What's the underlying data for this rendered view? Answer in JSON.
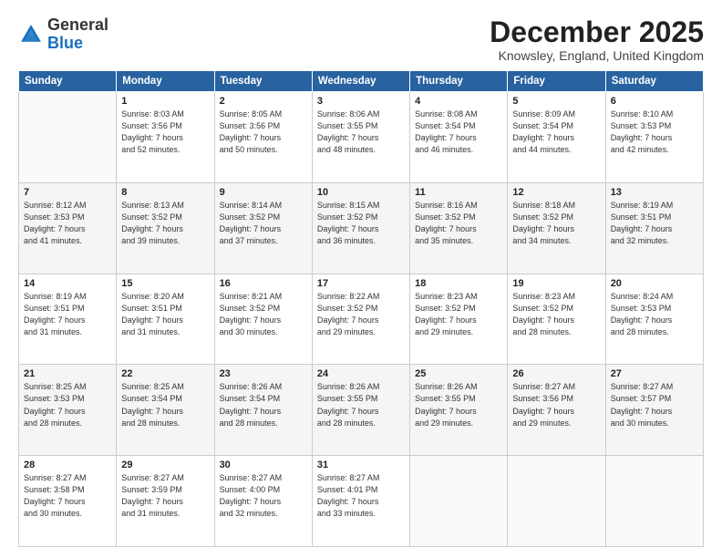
{
  "logo": {
    "general": "General",
    "blue": "Blue"
  },
  "title": "December 2025",
  "location": "Knowsley, England, United Kingdom",
  "days_of_week": [
    "Sunday",
    "Monday",
    "Tuesday",
    "Wednesday",
    "Thursday",
    "Friday",
    "Saturday"
  ],
  "weeks": [
    [
      {
        "day": "",
        "info": ""
      },
      {
        "day": "1",
        "info": "Sunrise: 8:03 AM\nSunset: 3:56 PM\nDaylight: 7 hours\nand 52 minutes."
      },
      {
        "day": "2",
        "info": "Sunrise: 8:05 AM\nSunset: 3:56 PM\nDaylight: 7 hours\nand 50 minutes."
      },
      {
        "day": "3",
        "info": "Sunrise: 8:06 AM\nSunset: 3:55 PM\nDaylight: 7 hours\nand 48 minutes."
      },
      {
        "day": "4",
        "info": "Sunrise: 8:08 AM\nSunset: 3:54 PM\nDaylight: 7 hours\nand 46 minutes."
      },
      {
        "day": "5",
        "info": "Sunrise: 8:09 AM\nSunset: 3:54 PM\nDaylight: 7 hours\nand 44 minutes."
      },
      {
        "day": "6",
        "info": "Sunrise: 8:10 AM\nSunset: 3:53 PM\nDaylight: 7 hours\nand 42 minutes."
      }
    ],
    [
      {
        "day": "7",
        "info": "Sunrise: 8:12 AM\nSunset: 3:53 PM\nDaylight: 7 hours\nand 41 minutes."
      },
      {
        "day": "8",
        "info": "Sunrise: 8:13 AM\nSunset: 3:52 PM\nDaylight: 7 hours\nand 39 minutes."
      },
      {
        "day": "9",
        "info": "Sunrise: 8:14 AM\nSunset: 3:52 PM\nDaylight: 7 hours\nand 37 minutes."
      },
      {
        "day": "10",
        "info": "Sunrise: 8:15 AM\nSunset: 3:52 PM\nDaylight: 7 hours\nand 36 minutes."
      },
      {
        "day": "11",
        "info": "Sunrise: 8:16 AM\nSunset: 3:52 PM\nDaylight: 7 hours\nand 35 minutes."
      },
      {
        "day": "12",
        "info": "Sunrise: 8:18 AM\nSunset: 3:52 PM\nDaylight: 7 hours\nand 34 minutes."
      },
      {
        "day": "13",
        "info": "Sunrise: 8:19 AM\nSunset: 3:51 PM\nDaylight: 7 hours\nand 32 minutes."
      }
    ],
    [
      {
        "day": "14",
        "info": "Sunrise: 8:19 AM\nSunset: 3:51 PM\nDaylight: 7 hours\nand 31 minutes."
      },
      {
        "day": "15",
        "info": "Sunrise: 8:20 AM\nSunset: 3:51 PM\nDaylight: 7 hours\nand 31 minutes."
      },
      {
        "day": "16",
        "info": "Sunrise: 8:21 AM\nSunset: 3:52 PM\nDaylight: 7 hours\nand 30 minutes."
      },
      {
        "day": "17",
        "info": "Sunrise: 8:22 AM\nSunset: 3:52 PM\nDaylight: 7 hours\nand 29 minutes."
      },
      {
        "day": "18",
        "info": "Sunrise: 8:23 AM\nSunset: 3:52 PM\nDaylight: 7 hours\nand 29 minutes."
      },
      {
        "day": "19",
        "info": "Sunrise: 8:23 AM\nSunset: 3:52 PM\nDaylight: 7 hours\nand 28 minutes."
      },
      {
        "day": "20",
        "info": "Sunrise: 8:24 AM\nSunset: 3:53 PM\nDaylight: 7 hours\nand 28 minutes."
      }
    ],
    [
      {
        "day": "21",
        "info": "Sunrise: 8:25 AM\nSunset: 3:53 PM\nDaylight: 7 hours\nand 28 minutes."
      },
      {
        "day": "22",
        "info": "Sunrise: 8:25 AM\nSunset: 3:54 PM\nDaylight: 7 hours\nand 28 minutes."
      },
      {
        "day": "23",
        "info": "Sunrise: 8:26 AM\nSunset: 3:54 PM\nDaylight: 7 hours\nand 28 minutes."
      },
      {
        "day": "24",
        "info": "Sunrise: 8:26 AM\nSunset: 3:55 PM\nDaylight: 7 hours\nand 28 minutes."
      },
      {
        "day": "25",
        "info": "Sunrise: 8:26 AM\nSunset: 3:55 PM\nDaylight: 7 hours\nand 29 minutes."
      },
      {
        "day": "26",
        "info": "Sunrise: 8:27 AM\nSunset: 3:56 PM\nDaylight: 7 hours\nand 29 minutes."
      },
      {
        "day": "27",
        "info": "Sunrise: 8:27 AM\nSunset: 3:57 PM\nDaylight: 7 hours\nand 30 minutes."
      }
    ],
    [
      {
        "day": "28",
        "info": "Sunrise: 8:27 AM\nSunset: 3:58 PM\nDaylight: 7 hours\nand 30 minutes."
      },
      {
        "day": "29",
        "info": "Sunrise: 8:27 AM\nSunset: 3:59 PM\nDaylight: 7 hours\nand 31 minutes."
      },
      {
        "day": "30",
        "info": "Sunrise: 8:27 AM\nSunset: 4:00 PM\nDaylight: 7 hours\nand 32 minutes."
      },
      {
        "day": "31",
        "info": "Sunrise: 8:27 AM\nSunset: 4:01 PM\nDaylight: 7 hours\nand 33 minutes."
      },
      {
        "day": "",
        "info": ""
      },
      {
        "day": "",
        "info": ""
      },
      {
        "day": "",
        "info": ""
      }
    ]
  ]
}
